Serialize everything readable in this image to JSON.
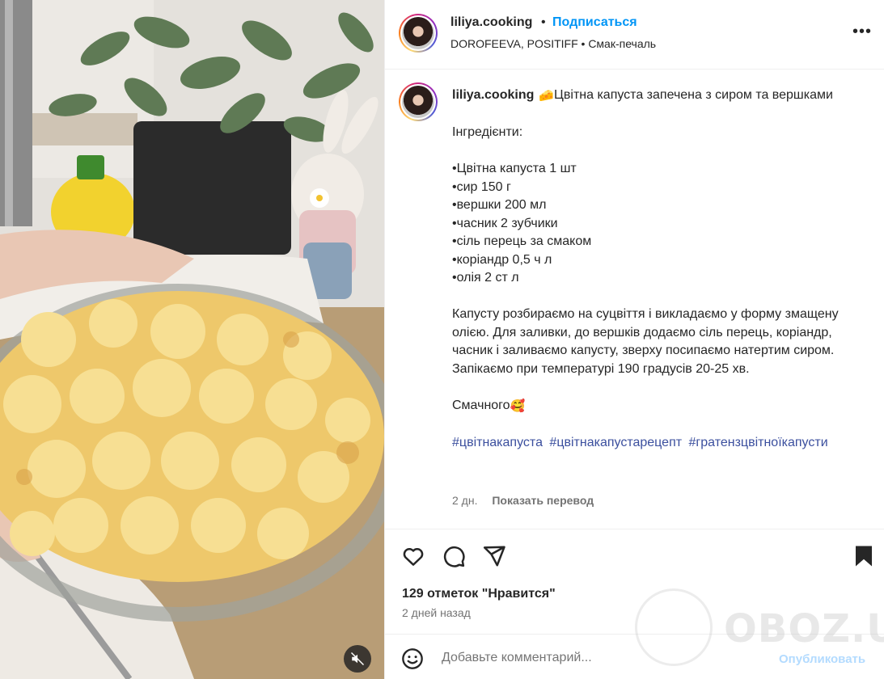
{
  "post": {
    "author": "liliya.cooking",
    "separator": "•",
    "follow_label": "Подписаться",
    "audio": "DOROFEEVA, POSITIFF • Смак-печаль",
    "more_label": "•••"
  },
  "caption": {
    "username": "liliya.cooking",
    "title_emoji": "🧀",
    "title": "Цвітна капуста запечена з сиром та вершками",
    "ingredients_heading": "Інгредієнти:",
    "ingredients": [
      "•Цвітна капуста 1 шт",
      "•сир 150 г",
      "•вершки 200 мл",
      "•часник 2 зубчики",
      "•сіль перець за смаком",
      "•коріандр 0,5 ч л",
      "•олія 2 ст л"
    ],
    "instructions": "Капусту розбираємо на суцвіття і викладаємо у форму змащену олією. Для заливки, до вершків додаємо сіль перець, коріандр, часник і заливаємо капусту, зверху посипаємо натертим сиром. Запікаємо при температурі 190 градусів 20-25 хв.",
    "closing": "Смачного",
    "closing_emoji": "🥰",
    "hashtags": [
      "#цвітнакапуста",
      "#цвітнакапустарецепт",
      "#гратензцвітноїкапусти"
    ],
    "age": "2 дн.",
    "translate_label": "Показать перевод"
  },
  "actions": {
    "likes": "129 отметок \"Нравится\"",
    "posted": "2 дней назад",
    "icons": [
      "heart-icon",
      "comment-icon",
      "share-icon",
      "bookmark-icon"
    ]
  },
  "comment": {
    "placeholder": "Добавьте комментарий...",
    "post_label": "Опубликовать"
  },
  "watermark": {
    "text": "OBOZ.UA"
  },
  "colors": {
    "accent": "#0095f6",
    "hashtag": "#3b4f9e",
    "muted": "#737373",
    "post_disabled": "#b3dbff"
  }
}
